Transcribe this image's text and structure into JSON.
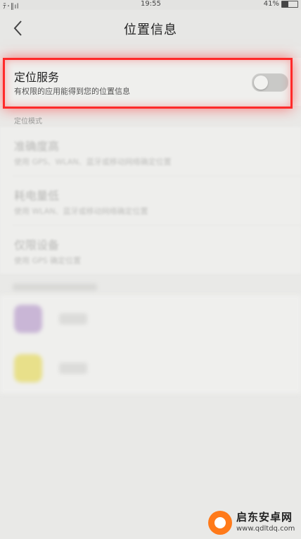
{
  "status_bar": {
    "left_text": "деж или",
    "time": "19:55",
    "battery": "41%"
  },
  "nav": {
    "title": "位置信息"
  },
  "location_service": {
    "title": "定位服务",
    "subtitle": "有权限的应用能得到您的位置信息",
    "enabled": false
  },
  "mode_section": {
    "label": "定位模式",
    "items": [
      {
        "title": "准确度高",
        "desc": "使用 GPS、WLAN、蓝牙或移动网络确定位置"
      },
      {
        "title": "耗电量低",
        "desc": "使用 WLAN、蓝牙或移动网络确定位置"
      },
      {
        "title": "仅限设备",
        "desc": "使用 GPS 确定位置"
      }
    ]
  },
  "apps": [
    {
      "icon": "app-icon",
      "color": "#c9b6d6"
    },
    {
      "icon": "app-icon",
      "color": "#e8e08a"
    }
  ],
  "watermark": {
    "name": "启东安卓网",
    "url": "www.qdltdq.com"
  },
  "colors": {
    "highlight": "#ff2a2a",
    "background": "#e9e9e7"
  }
}
